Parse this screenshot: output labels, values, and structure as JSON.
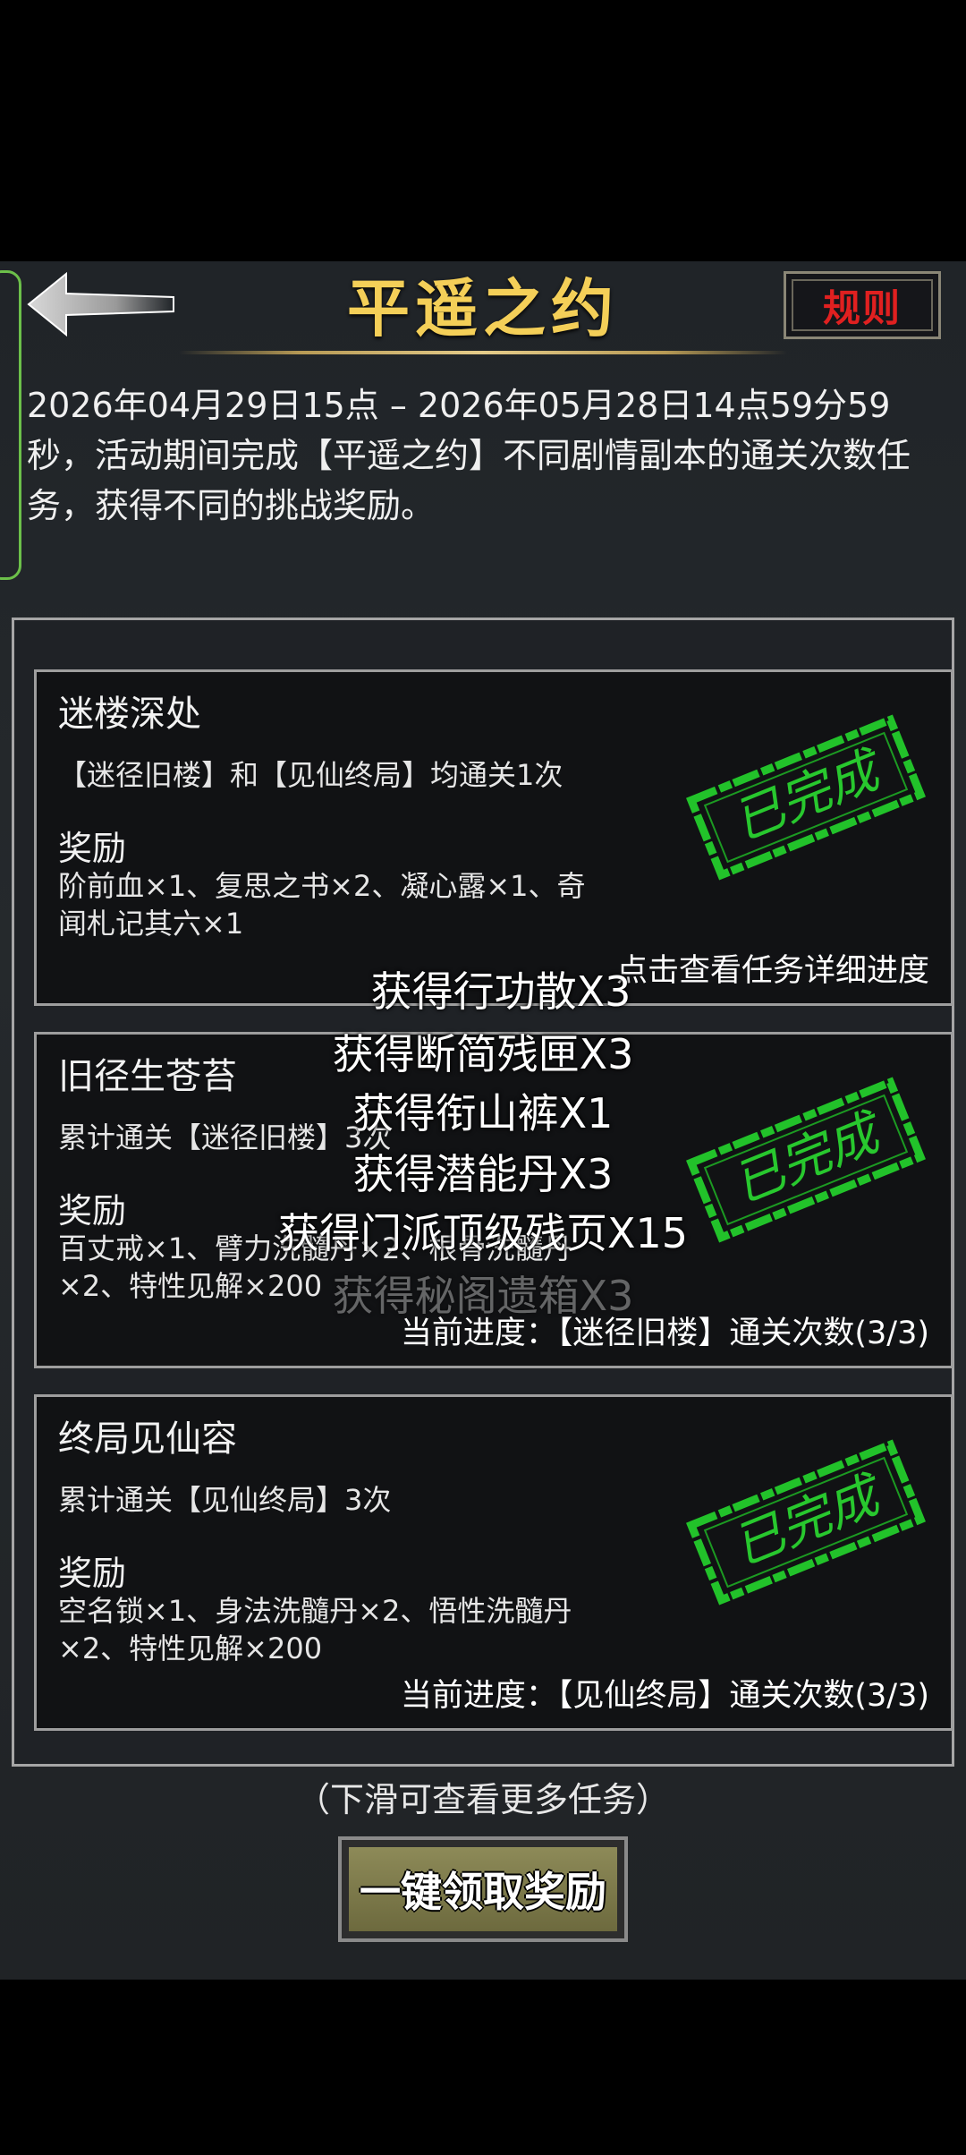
{
  "header": {
    "title": "平遥之约",
    "rule_label": "规则"
  },
  "description": "2026年04月29日15点 – 2026年05月28日14点59分59秒，活动期间完成【平遥之约】不同剧情副本的通关次数任务，获得不同的挑战奖励。",
  "stamp_text": "已完成",
  "tasks": [
    {
      "title": "迷楼深处",
      "condition": "【迷径旧楼】和【见仙终局】均通关1次",
      "reward_label": "奖励",
      "rewards": "阶前血×1、复思之书×2、凝心露×1、奇闻札记其六×1",
      "progress": "点击查看任务详细进度"
    },
    {
      "title": "旧径生苍苔",
      "condition": "累计通关【迷径旧楼】3次",
      "reward_label": "奖励",
      "rewards": "百丈戒×1、臂力洗髓丹×2、根骨洗髓丹×2、特性见解×200",
      "progress": "当前进度：【迷径旧楼】通关次数(3/3)"
    },
    {
      "title": "终局见仙容",
      "condition": "累计通关【见仙终局】3次",
      "reward_label": "奖励",
      "rewards": "空名锁×1、身法洗髓丹×2、悟性洗髓丹×2、特性见解×200",
      "progress": "当前进度：【见仙终局】通关次数(3/3)"
    }
  ],
  "floating_messages": [
    "获得行功散X3",
    "获得断简残匣X3",
    "获得衔山裤X1",
    "获得潜能丹X3",
    "获得门派顶级残页X15",
    "获得秘阁遗箱X3"
  ],
  "scroll_hint": "（下滑可查看更多任务）",
  "claim_button": "一键领取奖励",
  "colors": {
    "title_gold": "#f4cf58",
    "stamp_green": "#22c22a",
    "rule_red": "#e02020",
    "side_tab_green": "#6cc04a"
  }
}
